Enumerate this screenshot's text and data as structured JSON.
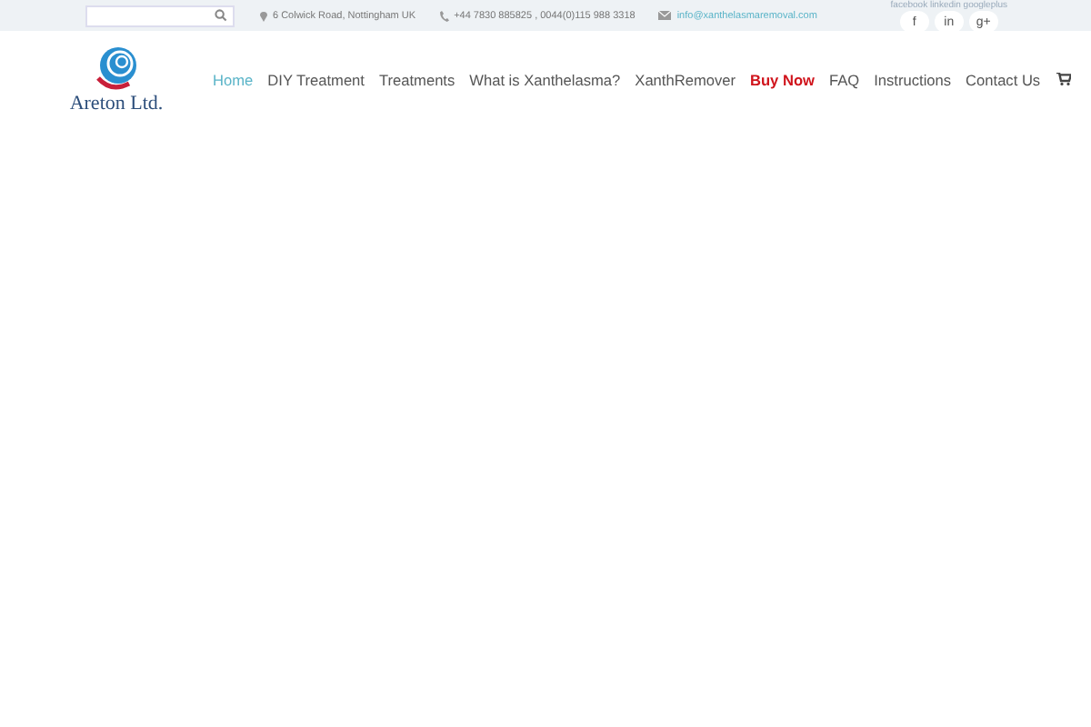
{
  "top_bar": {
    "address": "6 Colwick Road, Nottingham UK",
    "phone": "+44 7830 885825 , 0044(0)115 988 3318",
    "email": "info@xanthelasmaremoval.com",
    "social_caption": "facebook linkedin googleplus",
    "social": [
      {
        "label": "f"
      },
      {
        "label": "in"
      },
      {
        "label": "g+"
      }
    ]
  },
  "logo": {
    "text": "Areton Ltd."
  },
  "nav": [
    {
      "label": "Home",
      "selected": true,
      "kind": "link"
    },
    {
      "label": "DIY Treatment",
      "selected": false,
      "kind": "link"
    },
    {
      "label": "Treatments",
      "selected": false,
      "kind": "link"
    },
    {
      "label": "What is Xanthelasma?",
      "selected": false,
      "kind": "link"
    },
    {
      "label": "XanthRemover",
      "selected": false,
      "kind": "link"
    },
    {
      "label": "Buy Now",
      "selected": false,
      "kind": "highlight"
    },
    {
      "label": "FAQ",
      "selected": false,
      "kind": "link"
    },
    {
      "label": "Instructions",
      "selected": false,
      "kind": "link"
    },
    {
      "label": "Contact Us",
      "selected": false,
      "kind": "link"
    }
  ]
}
